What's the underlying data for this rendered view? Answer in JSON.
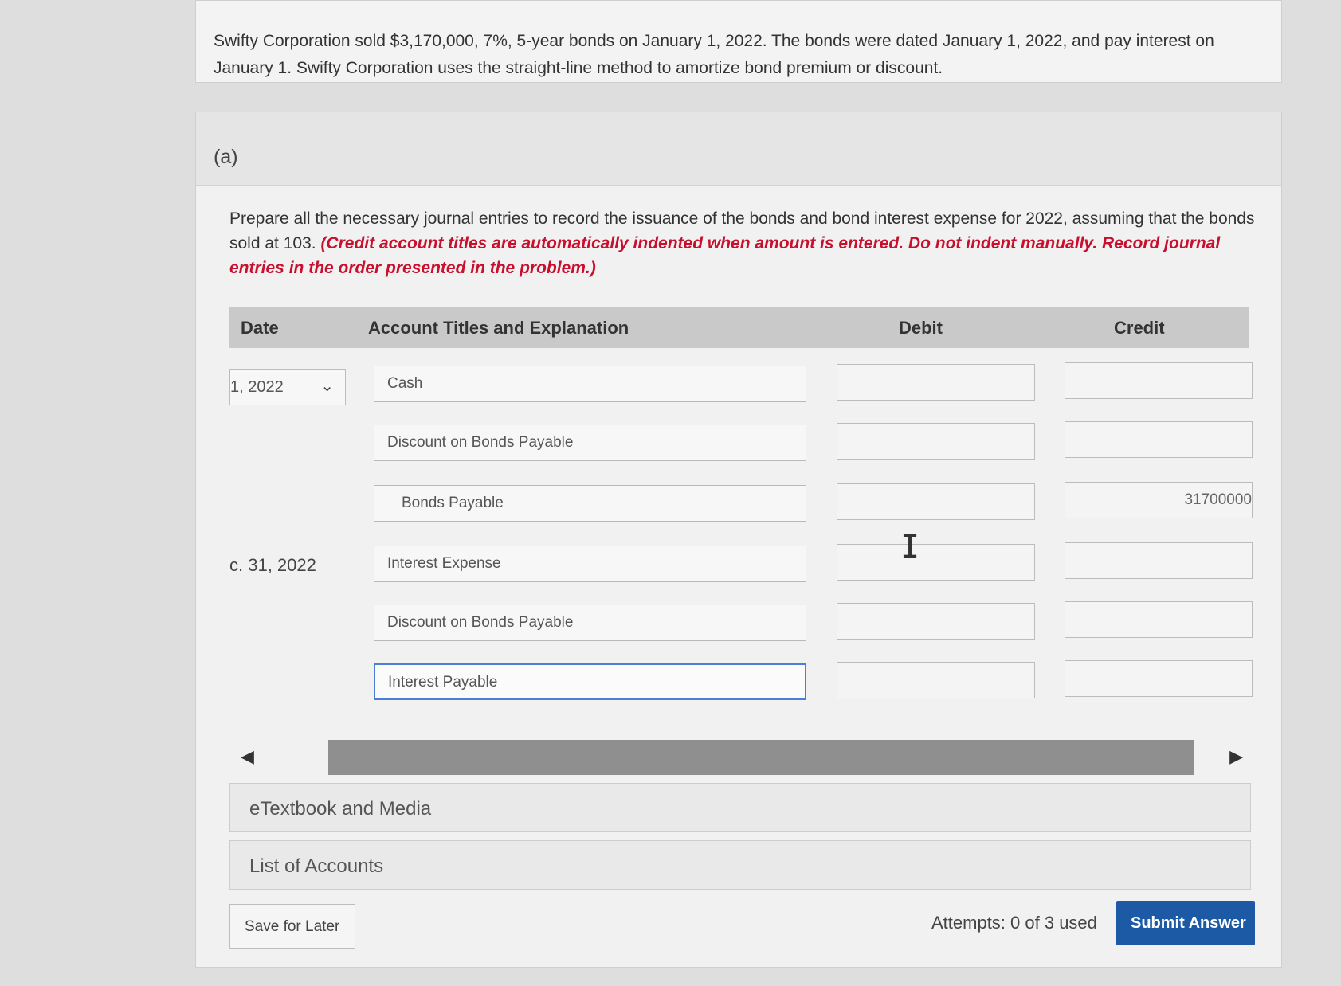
{
  "problem": {
    "text": "Swifty Corporation sold $3,170,000, 7%, 5-year bonds on January 1, 2022. The bonds were dated January 1, 2022, and pay interest on January 1. Swifty Corporation uses the straight-line method to amortize bond premium or discount."
  },
  "part": {
    "label": "(a)",
    "instruction": "Prepare all the necessary journal entries to record the issuance of the bonds and bond interest expense for 2022, assuming that the bonds sold at 103.",
    "instruction_red": "(Credit account titles are automatically indented when amount is entered. Do not indent manually. Record journal entries in the order presented in the problem.)"
  },
  "table": {
    "headers": {
      "date": "Date",
      "account": "Account Titles and Explanation",
      "debit": "Debit",
      "credit": "Credit"
    },
    "entries": [
      {
        "date": "1, 2022",
        "account": "Cash",
        "debit": "",
        "credit": ""
      },
      {
        "date": "",
        "account": "Discount on Bonds Payable",
        "debit": "",
        "credit": ""
      },
      {
        "date": "",
        "account": "Bonds Payable",
        "debit": "",
        "credit": "31700000"
      },
      {
        "date": "c. 31, 2022",
        "account": "Interest Expense",
        "debit": "",
        "credit": ""
      },
      {
        "date": "",
        "account": "Discount on Bonds Payable",
        "debit": "",
        "credit": ""
      },
      {
        "date": "",
        "account": "Interest Payable",
        "debit": "",
        "credit": ""
      }
    ]
  },
  "sections": {
    "etextbook": "eTextbook and Media",
    "accounts": "List of Accounts"
  },
  "footer": {
    "save_label": "Save for Later",
    "attempts": "Attempts: 0 of 3 used",
    "submit_label": "Submit Answer"
  },
  "colors": {
    "submit": "#1d5aa6",
    "instruction_red": "#c8102e",
    "focus_border": "#4a7fd6"
  }
}
